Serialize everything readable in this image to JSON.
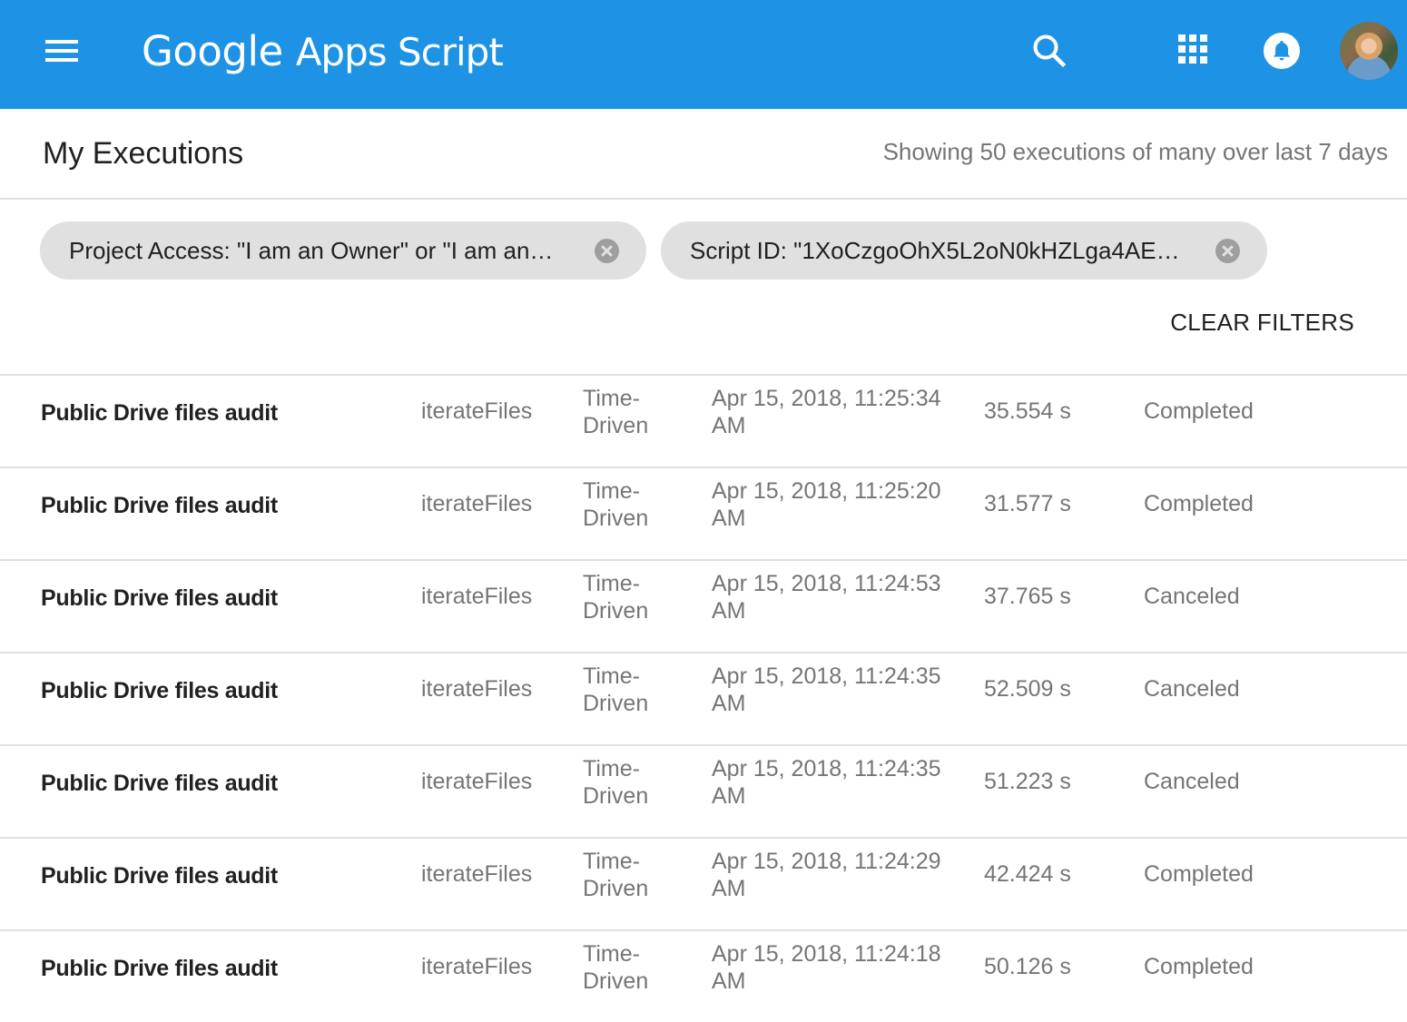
{
  "appbar": {
    "brand_google": "Google",
    "brand_product": "Apps Script",
    "bg_color": "#1e93e6",
    "icons": [
      "menu-icon",
      "search-icon",
      "apps-grid-icon",
      "notifications-bell-icon",
      "account-avatar"
    ]
  },
  "page": {
    "title": "My Executions",
    "showing": "Showing 50 executions of many over last 7 days"
  },
  "filters": {
    "chips": [
      {
        "label": "Project Access: \"I am an Owner\" or \"I am an…"
      },
      {
        "label": "Script ID: \"1XoCzgoOhX5L2oN0kHZLga4AE…"
      }
    ],
    "clear_label": "CLEAR FILTERS"
  },
  "executions": [
    {
      "project": "Public Drive files audit",
      "function": "iterateFiles",
      "type_line1": "Time-",
      "type_line2": "Driven",
      "date_line1": "Apr 15, 2018, 11:25:34",
      "date_line2": "AM",
      "duration": "35.554 s",
      "status": "Completed"
    },
    {
      "project": "Public Drive files audit",
      "function": "iterateFiles",
      "type_line1": "Time-",
      "type_line2": "Driven",
      "date_line1": "Apr 15, 2018, 11:25:20",
      "date_line2": "AM",
      "duration": "31.577 s",
      "status": "Completed"
    },
    {
      "project": "Public Drive files audit",
      "function": "iterateFiles",
      "type_line1": "Time-",
      "type_line2": "Driven",
      "date_line1": "Apr 15, 2018, 11:24:53",
      "date_line2": "AM",
      "duration": "37.765 s",
      "status": "Canceled"
    },
    {
      "project": "Public Drive files audit",
      "function": "iterateFiles",
      "type_line1": "Time-",
      "type_line2": "Driven",
      "date_line1": "Apr 15, 2018, 11:24:35",
      "date_line2": "AM",
      "duration": "52.509 s",
      "status": "Canceled"
    },
    {
      "project": "Public Drive files audit",
      "function": "iterateFiles",
      "type_line1": "Time-",
      "type_line2": "Driven",
      "date_line1": "Apr 15, 2018, 11:24:35",
      "date_line2": "AM",
      "duration": "51.223 s",
      "status": "Canceled"
    },
    {
      "project": "Public Drive files audit",
      "function": "iterateFiles",
      "type_line1": "Time-",
      "type_line2": "Driven",
      "date_line1": "Apr 15, 2018, 11:24:29",
      "date_line2": "AM",
      "duration": "42.424 s",
      "status": "Completed"
    },
    {
      "project": "Public Drive files audit",
      "function": "iterateFiles",
      "type_line1": "Time-",
      "type_line2": "Driven",
      "date_line1": "Apr 15, 2018, 11:24:18",
      "date_line2": "AM",
      "duration": "50.126 s",
      "status": "Completed"
    }
  ]
}
